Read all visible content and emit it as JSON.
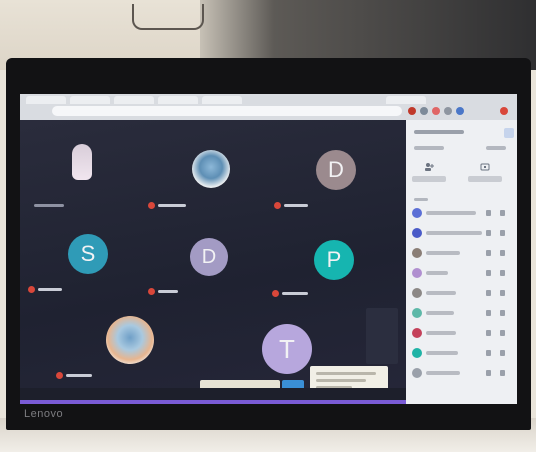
{
  "scene": {
    "laptop_brand": "Lenovo"
  },
  "colors": {
    "meet_background": "#232536",
    "panel_background": "#eef0f3",
    "mic_off_red": "#d9473a",
    "purple_strip": "#7a5bd6",
    "send_blue": "#3a8fd6"
  },
  "meeting": {
    "tiles": [
      {
        "letter": "",
        "color": "#ffffff",
        "avatar_type": "figure"
      },
      {
        "letter": "",
        "color": "#9fc3e0",
        "avatar_type": "photo"
      },
      {
        "letter": "D",
        "color": "#9b8a8e",
        "avatar_type": "letter"
      },
      {
        "letter": "S",
        "color": "#2f9bb7",
        "avatar_type": "letter"
      },
      {
        "letter": "D",
        "color": "#a39bc4",
        "avatar_type": "letter"
      },
      {
        "letter": "P",
        "color": "#16b5b0",
        "avatar_type": "letter"
      },
      {
        "letter": "",
        "color": "#e2b48e",
        "avatar_type": "photo"
      },
      {
        "letter": "T",
        "color": "#b7a7dd",
        "avatar_type": "letter"
      }
    ]
  },
  "panel": {
    "participant_avatar_colors": [
      "#5b6fd6",
      "#4a5bc8",
      "#8a7e76",
      "#b08fd0",
      "#8c8886",
      "#5db8a8",
      "#c4415a",
      "#1fb3a6",
      "#9aa0aa"
    ]
  },
  "icons": {
    "panel_add": "add-person-icon",
    "panel_share": "share-icon",
    "mic_off": "mic-off-icon",
    "close": "close-icon"
  }
}
